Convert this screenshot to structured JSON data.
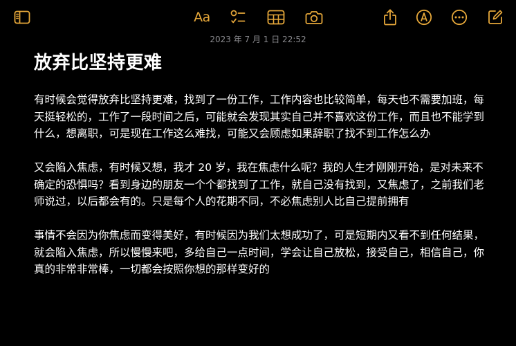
{
  "app": {
    "accent_color": "#E7A83A",
    "background_color": "#000000"
  },
  "toolbar": {
    "left": [
      {
        "icon": "sidebar-icon"
      }
    ],
    "center": [
      {
        "icon": "text-format-icon",
        "label": "Aa"
      },
      {
        "icon": "checklist-icon"
      },
      {
        "icon": "table-icon"
      },
      {
        "icon": "camera-icon"
      }
    ],
    "right": [
      {
        "icon": "share-icon"
      },
      {
        "icon": "markup-pen-icon"
      },
      {
        "icon": "more-icon"
      },
      {
        "icon": "compose-icon"
      }
    ]
  },
  "note": {
    "timestamp": "2023 年 7 月 1 日 22:52",
    "title": "放弃比坚持更难",
    "paragraphs": [
      "有时候会觉得放弃比坚持更难，找到了一份工作，工作内容也比较简单，每天也不需要加班，每天挺轻松的，工作了一段时间之后，可能就会发现其实自己并不喜欢这份工作，而且也不能学到什么，想离职，可是现在工作这么难找，可能又会顾虑如果辞职了找不到工作怎么办",
      "又会陷入焦虑，有时候又想，我才 20 岁，我在焦虑什么呢？我的人生才刚刚开始，是对未来不确定的恐惧吗？看到身边的朋友一个个都找到了工作，就自己没有找到，又焦虑了，之前我们老师说过，以后都会有的。只是每个人的花期不同，不必焦虑别人比自己提前拥有",
      "事情不会因为你焦虑而变得美好，有时候因为我们太想成功了，可是短期内又看不到任何结果，就会陷入焦虑，所以慢慢来吧，多给自己一点时间，学会让自己放松，接受自己，相信自己，你真的非常非常棒，一切都会按照你想的那样变好的"
    ]
  }
}
